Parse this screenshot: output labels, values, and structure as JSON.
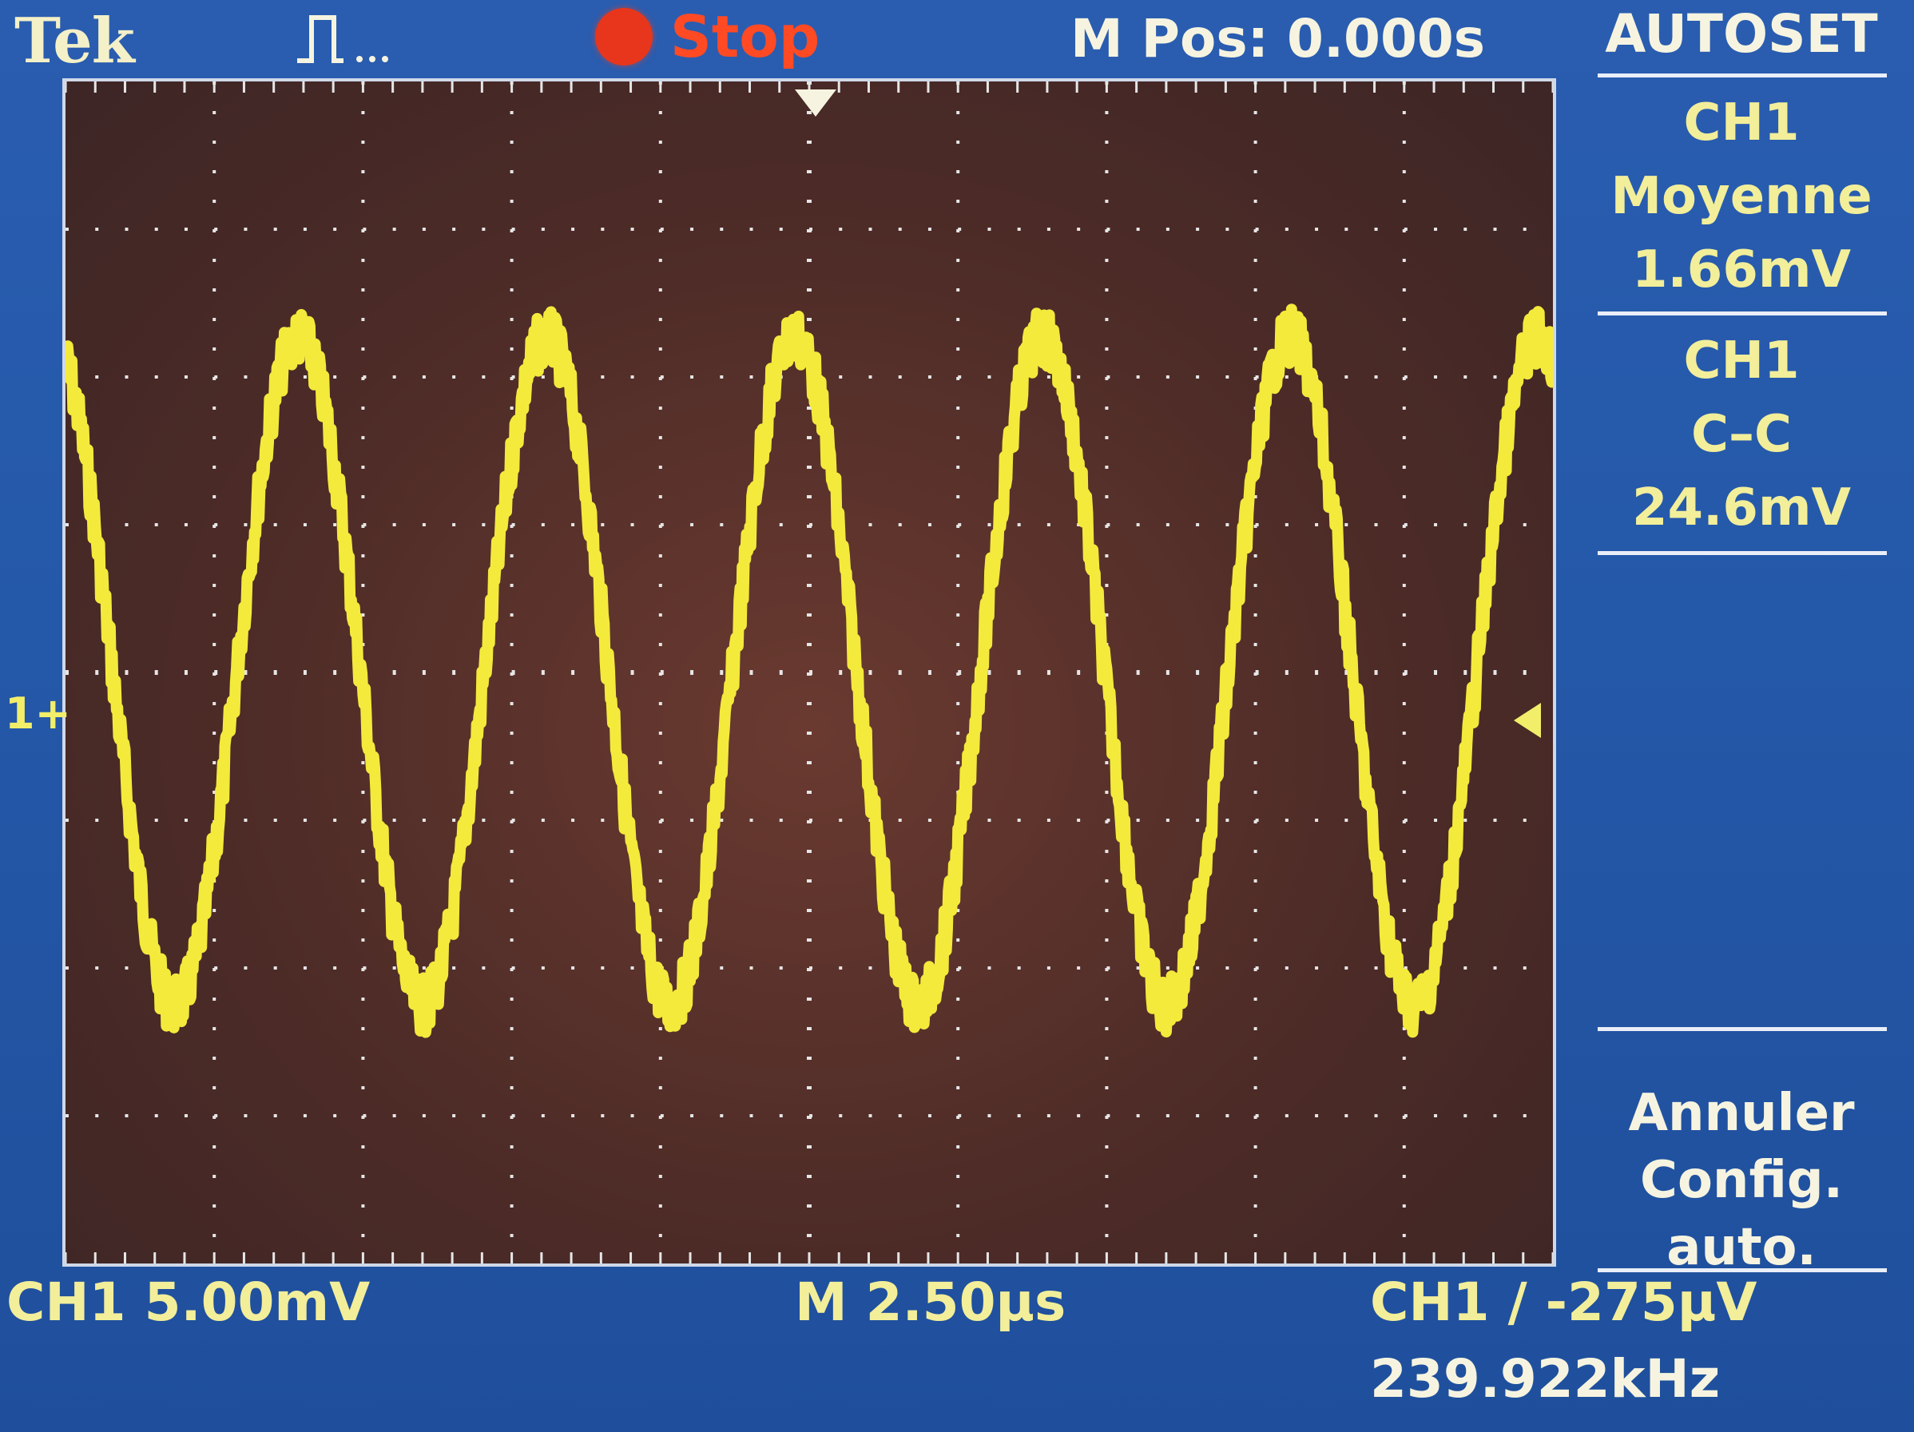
{
  "header": {
    "brand": "Tek",
    "acquisition_icon": "pulse-waveform-icon",
    "run_state": "Stop",
    "run_state_color": "#e8361c",
    "m_pos": "M Pos: 0.000s"
  },
  "side_menu": {
    "title": "AUTOSET",
    "measure1": {
      "line1": "CH1",
      "line2": "Moyenne",
      "line3": "1.66mV"
    },
    "measure2": {
      "line1": "CH1",
      "line2": "C–C",
      "line3": "24.6mV"
    },
    "action": {
      "line1": "Annuler",
      "line2": "Config. auto."
    }
  },
  "markers": {
    "channel_marker": "1+"
  },
  "status_bar": {
    "ch1_scale": "CH1  5.00mV",
    "timebase": "M 2.50µs",
    "trigger": "CH1 ∕ -275µV",
    "frequency": "239.922kHz"
  },
  "colors": {
    "trace": "#f3ea3c",
    "background": "#2458a8",
    "plot_bg": "#4d2b27"
  },
  "chart_data": {
    "type": "line",
    "title": "",
    "xlabel": "",
    "ylabel": "",
    "grid": true,
    "series": [
      {
        "signal": "sine",
        "frequency_khz": 239.922,
        "peak_to_peak_mv": 24.6,
        "mean_mv": 1.66,
        "vertical_scale_mv_per_div": 5.0,
        "horizontal_scale_us_per_div": 2.5,
        "noisy": true
      }
    ]
  }
}
